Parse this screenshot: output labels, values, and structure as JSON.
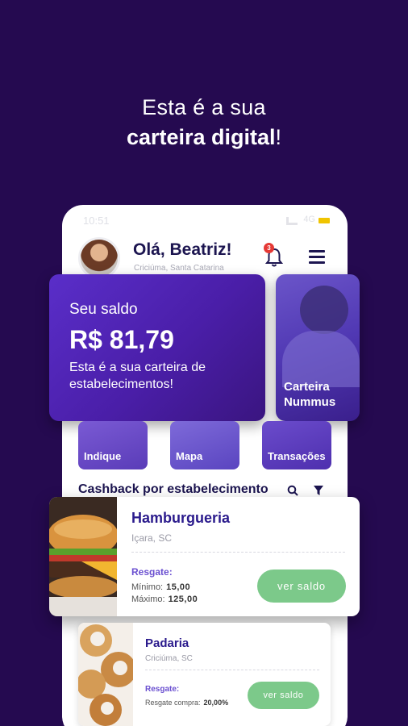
{
  "headline": {
    "line1": "Esta é a sua",
    "line2_bold": "carteira digital",
    "line2_tail": "!"
  },
  "statusbar": {
    "time": "10:51",
    "network": "4G"
  },
  "header": {
    "greeting": "Olá, Beatriz!",
    "location": "Criciúma, Santa Catarina",
    "notifications_count": "3"
  },
  "saldo": {
    "label": "Seu saldo",
    "value": "R$ 81,79",
    "description": "Esta é a sua carteira de estabelecimentos!"
  },
  "nummus": {
    "title_line1": "Carteira",
    "title_line2": "Nummus"
  },
  "tiles": [
    {
      "label": "Indique"
    },
    {
      "label": "Mapa"
    },
    {
      "label": "Transações"
    }
  ],
  "cashback": {
    "title": "Cashback por estabelecimento"
  },
  "establishments": [
    {
      "name": "Hamburgueria",
      "location": "Içara, SC",
      "resgate_label": "Resgate:",
      "min_label": "Mínimo:",
      "min_value": "15,00",
      "max_label": "Máximo:",
      "max_value": "125,00",
      "button": "ver saldo"
    },
    {
      "name": "Padaria",
      "location": "Criciúma, SC",
      "resgate_label": "Resgate:",
      "compra_label": "Resgate compra:",
      "compra_value": "20,00%",
      "button": "ver saldo"
    }
  ],
  "colors": {
    "background": "#250a50",
    "accent": "#5a2ec9",
    "button_green": "#7cc98a",
    "title_text": "#2a1a8c"
  }
}
